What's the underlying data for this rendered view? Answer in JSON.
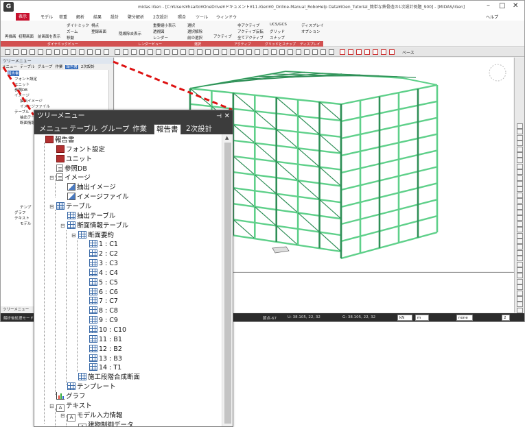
{
  "app": {
    "logo_text": "G",
    "window_title": "midas iGen - [C:¥Users¥hsaito¥OneDrive¥ドキュメント¥11.iGen¥0_Online-Manual_RoboHelp Data¥iGen_Tutorial_簡単な鉄骨造の1次設計例題_900] - [MIDAS/iGen]",
    "menu_tabs": [
      "表示",
      "モデル",
      "荷重",
      "解析",
      "結果",
      "設計",
      "壁分解析",
      "2次設計",
      "照合",
      "ツール",
      "ウィンドウ"
    ],
    "active_menu_tab": "表示",
    "help_label": "ヘルプ",
    "ribbon": {
      "buttons": [
        "再描画",
        "初期画面",
        "前画面を表示",
        "ダイナミック",
        "ズーム",
        "移動",
        "視点",
        "登録画面",
        "隠線除去表示",
        "重要縮小表示",
        "透視図",
        "レンダー",
        "選択",
        "選択解除",
        "前の選択",
        "アクティブ",
        "非アクティブ",
        "アクティブ反転",
        "全てアクティブ",
        "UCS/GCS",
        "グリッド",
        "スナップ",
        "ディスプレイ",
        "オプション"
      ],
      "groups": [
        "ダイナミックビュー",
        "レンダービュー",
        "選択",
        "アクティブ",
        "グリッドとスナップ",
        "ディスプレイ"
      ]
    },
    "toolbar_label": "ベース"
  },
  "left_panel": {
    "title": "ツリーメニュー",
    "tabs": [
      "メニュー",
      "テーブル",
      "グループ",
      "作業",
      "報告書",
      "2次設計"
    ],
    "active_tab": "報告書",
    "rows": [
      "報告書",
      "フォント設定",
      "ユニット",
      "参照DB",
      "イメージ",
      "抽出イメージ",
      "イメージファイル",
      "テーブル",
      "抽出テーブル",
      "断面情報",
      "テンプ",
      "グラフ",
      "テキスト",
      "モデル"
    ],
    "bottom_tab": "ツリーメニュー"
  },
  "status_bar": {
    "message": "解析後処理モード",
    "node": "節点-67",
    "u_coord": "U: 38.105, 22, 32",
    "g_coord": "G: 38.105, 22, 32",
    "unit_force": "kN",
    "unit_length": "m",
    "mode": "none",
    "page": "2"
  },
  "tree_panel": {
    "title": "ツリーメニュー",
    "pin_icon": "pin-icon",
    "tabs": [
      "メニュー",
      "テーブル",
      "グループ",
      "作業",
      "報告書",
      "2次設計"
    ],
    "active_tab": "報告書",
    "nodes": [
      {
        "label": "報告書",
        "icon": "report-icon"
      },
      {
        "label": "フォント設定",
        "icon": "font-settings-icon"
      },
      {
        "label": "ユニット",
        "icon": "unit-icon"
      },
      {
        "label": "参照DB",
        "icon": "reference-db-icon"
      },
      {
        "label": "イメージ",
        "icon": "image-folder-icon"
      },
      {
        "label": "抽出イメージ",
        "icon": "extracted-image-icon"
      },
      {
        "label": "イメージファイル",
        "icon": "image-file-icon"
      },
      {
        "label": "テーブル",
        "icon": "table-icon"
      },
      {
        "label": "抽出テーブル",
        "icon": "extracted-table-icon"
      },
      {
        "label": "断面情報テーブル",
        "icon": "table-icon"
      },
      {
        "label": "断面要約",
        "icon": "table-icon"
      },
      {
        "label": "1 : C1",
        "icon": "table-icon"
      },
      {
        "label": "2 : C2",
        "icon": "table-icon"
      },
      {
        "label": "3 : C3",
        "icon": "table-icon"
      },
      {
        "label": "4 : C4",
        "icon": "table-icon"
      },
      {
        "label": "5 : C5",
        "icon": "table-icon"
      },
      {
        "label": "6 : C6",
        "icon": "table-icon"
      },
      {
        "label": "7 : C7",
        "icon": "table-icon"
      },
      {
        "label": "8 : C8",
        "icon": "table-icon"
      },
      {
        "label": "9 : C9",
        "icon": "table-icon"
      },
      {
        "label": "10 : C10",
        "icon": "table-icon"
      },
      {
        "label": "11 : B1",
        "icon": "table-icon"
      },
      {
        "label": "12 : B2",
        "icon": "table-icon"
      },
      {
        "label": "13 : B3",
        "icon": "table-icon"
      },
      {
        "label": "14 : T1",
        "icon": "table-icon"
      },
      {
        "label": "施工段階合成断面",
        "icon": "table-icon"
      },
      {
        "label": "テンプレート",
        "icon": "template-icon"
      },
      {
        "label": "グラフ",
        "icon": "graph-icon"
      },
      {
        "label": "テキスト",
        "icon": "text-icon"
      },
      {
        "label": "モデル入力情報",
        "icon": "text-doc-icon"
      },
      {
        "label": "建物制御データ",
        "icon": "text-doc-icon"
      }
    ]
  },
  "colors": {
    "accent_red": "#c8102e",
    "structure_green": "#5fd08a",
    "panel_dark": "#3c3c3c",
    "callout_red": "#dd1111"
  }
}
